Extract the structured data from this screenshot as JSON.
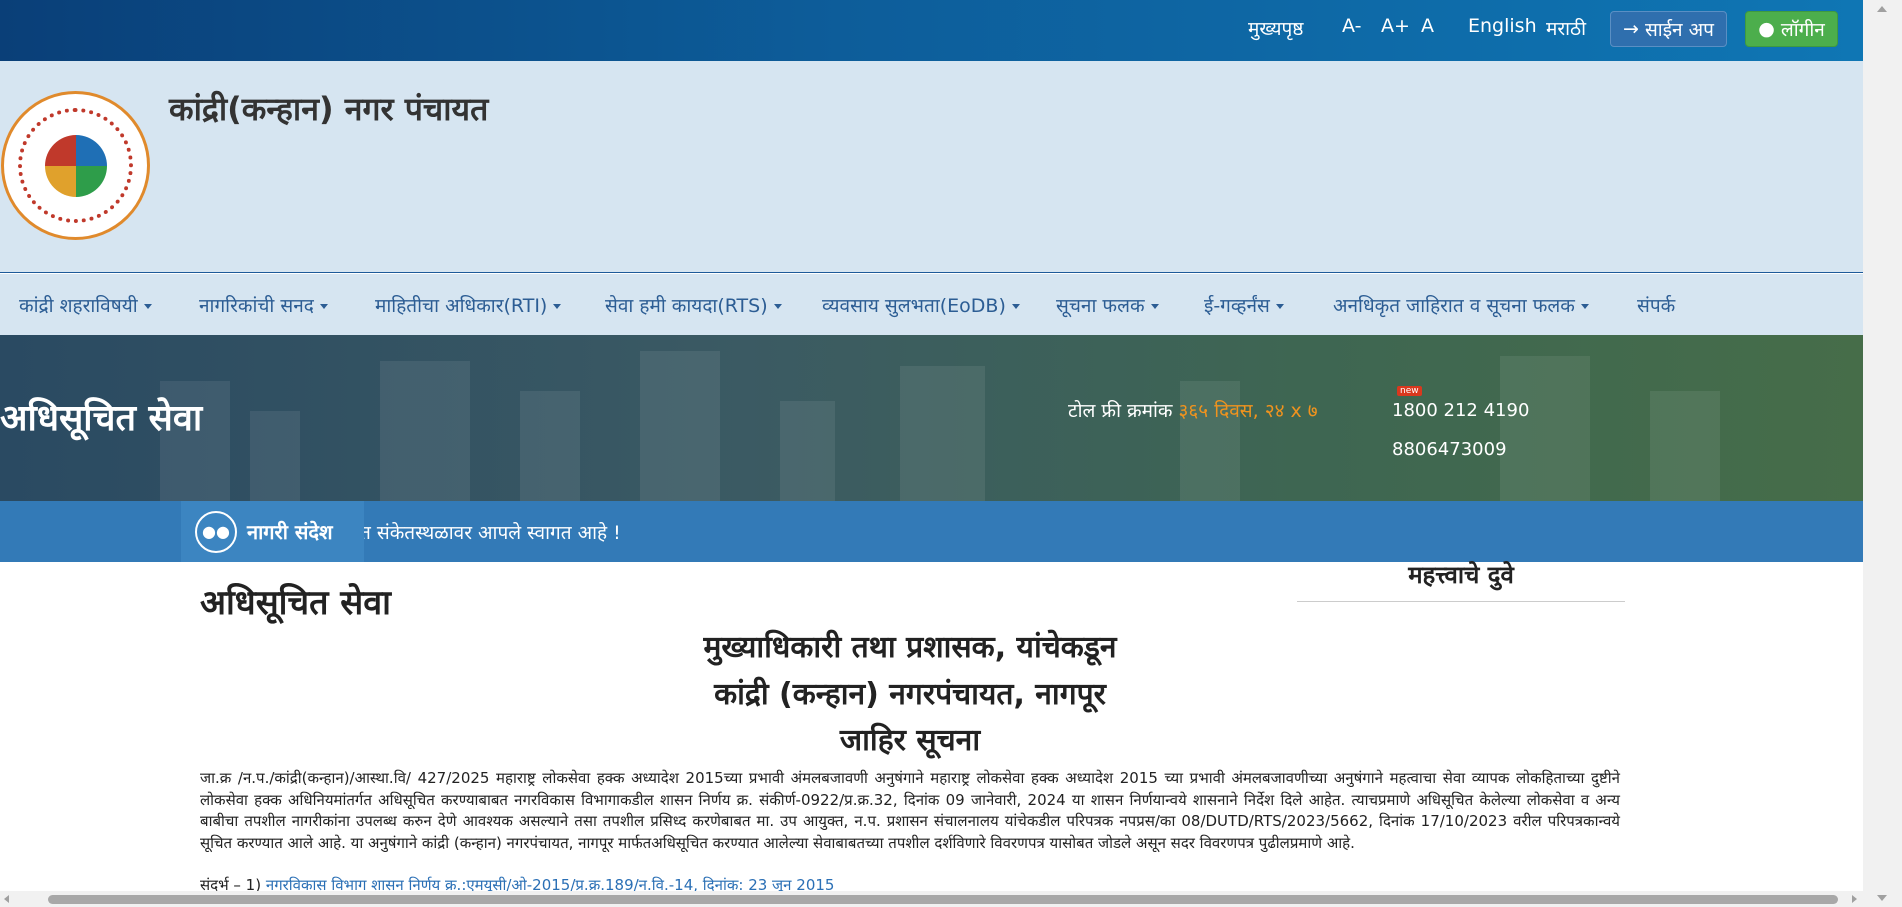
{
  "topbar": {
    "home": "मुख्यपृष्ठ",
    "font_decrease": "A-",
    "font_increase": "A+",
    "font_reset": "A",
    "lang_english": "English",
    "lang_marathi": "मराठी",
    "signup_label": "साईन अप",
    "login_label": "लॉगीन",
    "bar_color": "#0d5d9a",
    "signup_color": "#2f6fae",
    "login_color": "#4cae4c"
  },
  "header": {
    "title": "कांद्री(कन्हान) नगर पंचायत",
    "background": "#d6e5f1"
  },
  "nav": {
    "items": [
      {
        "label": "कांद्री शहराविषयी",
        "dropdown": true
      },
      {
        "label": "नागरिकांची सनद",
        "dropdown": true
      },
      {
        "label": "माहितीचा अधिकार(RTI)",
        "dropdown": true
      },
      {
        "label": "सेवा हमी कायदा(RTS)",
        "dropdown": true
      },
      {
        "label": "व्यवसाय सुलभता(EoDB)",
        "dropdown": true
      },
      {
        "label": "सूचना फलक",
        "dropdown": true
      },
      {
        "label": "ई-गव्हर्नंस",
        "dropdown": true
      },
      {
        "label": "अनधिकृत जाहिरात व सूचना फलक",
        "dropdown": true
      },
      {
        "label": "संपर्क",
        "dropdown": false
      }
    ],
    "text_color": "#2c5d94"
  },
  "banner": {
    "title": "अधिसूचित सेवा",
    "tollfree_label": "टोल फ्री क्रमांक",
    "tollfree_hours": "३६५ दिवस, २४ x ७",
    "new_badge": "new",
    "phone1": "1800 212 4190",
    "phone2": "8806473009",
    "accent": "#f0931e"
  },
  "ticker": {
    "label": "नागरी संदेश",
    "message": "त संकेतस्थळावर आपले स्वागत आहे !",
    "background": "#337ab7"
  },
  "main": {
    "title": "अधिसूचित सेवा",
    "notice_line1": "मुख्याधिकारी तथा प्रशासक, यांचेकडून",
    "notice_line2": "कांद्री (कन्हान) नगरपंचायत, नागपूर",
    "notice_line3": "जाहिर सूचना",
    "body": "जा.क्र /न.प./कांद्री(कन्हान)/आस्था.वि/  427/2025 महाराष्ट्र लोकसेवा हक्क अध्यादेश 2015च्या प्रभावी अंमलबजावणी अनुषंगाने महाराष्ट्र लोकसेवा हक्क अध्यादेश 2015 च्या प्रभावी अंमलबजावणीच्या अनुषंगाने महत्वाचा सेवा व्यापक लोकहिताच्या दुष्टीने लोकसेवा हक्क  अधिनियमांतर्गत अधिसूचित करण्याबाबत नगरविकास विभागाकडील शासन निर्णय क्र. संकीर्ण-0922/प्र.क्र.32, दिनांक 09 जानेवारी, 2024 या शासन निर्णयान्वये शासनाने निर्देश दिले आहेत. त्याचप्रमाणे अधिसूचित केलेल्या लोकसेवा व अन्य बाबीचा तपशील नागरीकांना उपलब्ध करुन देणे आवश्यक असल्याने तसा तपशील प्रसिध्द करणेबाबत मा. उप आयुक्त, न.प. प्रशासन संचालनालय यांचेकडील परिपत्रक नपप्रस/का 08/DUTD/RTS/2023/5662, दिनांक 17/10/2023 वरील परिपत्रकान्वये सूचित करण्यात आले आहे. या अनुषंगाने कांद्री (कन्हान) नगरपंचायत, नागपूर मार्फतअधिसूचित करण्यात आलेल्या सेवाबाबतच्या तपशील दर्शविणारे विवरणपत्र यासोबत जोडले असून सदर विवरणपत्र पुढीलप्रमाणे आहे.",
    "ref_prefix": "संदर्भ – 1)",
    "ref_link": "नगरविकास विभाग शासन निर्णय क्र.:एमयूसी/ओ-2015/प्र.क्र.189/न.वि.-14, दिनांक: 23 जून 2015"
  },
  "sidebar": {
    "title": "महत्त्वाचे दुवे"
  }
}
